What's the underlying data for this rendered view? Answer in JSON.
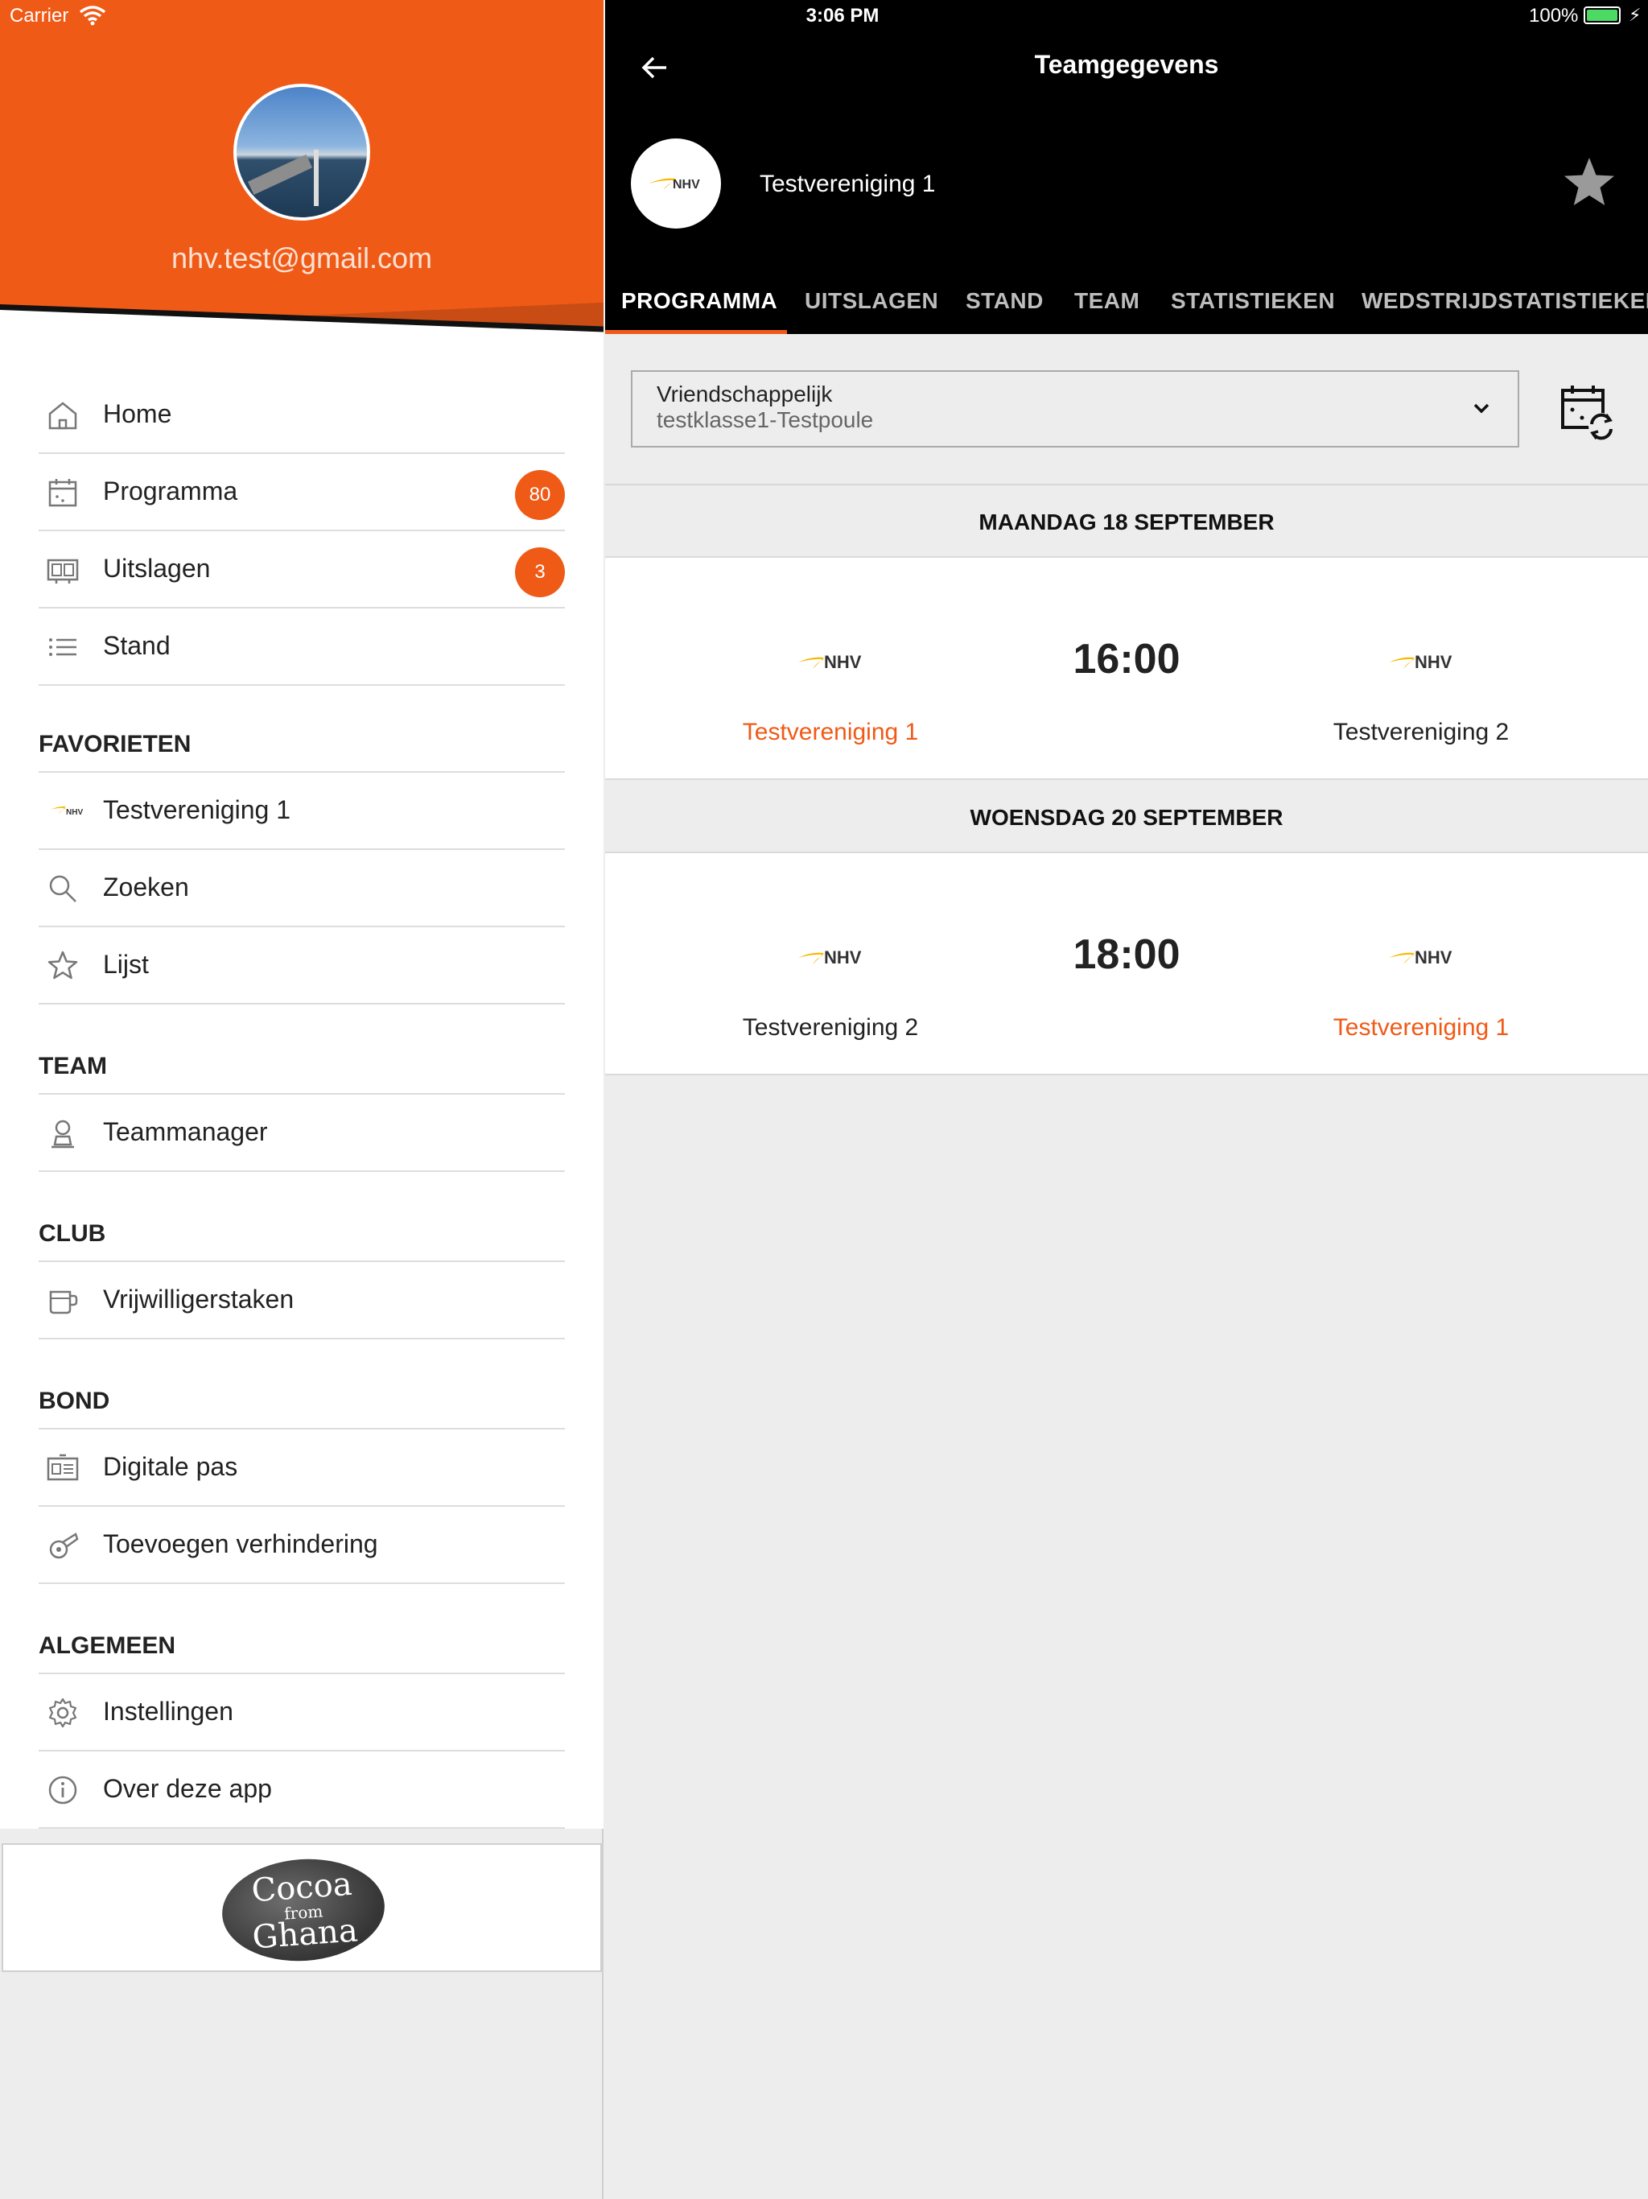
{
  "status_bar": {
    "carrier": "Carrier",
    "time": "3:06 PM",
    "battery": "100%"
  },
  "sidebar": {
    "email": "nhv.test@gmail.com",
    "items": [
      {
        "label": "Home",
        "icon": "home-icon"
      },
      {
        "label": "Programma",
        "icon": "calendar-icon",
        "badge": "80"
      },
      {
        "label": "Uitslagen",
        "icon": "scoreboard-icon",
        "badge": "3"
      },
      {
        "label": "Stand",
        "icon": "list-icon"
      }
    ],
    "sections": {
      "favorieten": {
        "title": "FAVORIETEN",
        "items": [
          {
            "label": "Testvereniging 1",
            "icon": "nhv-logo-icon"
          },
          {
            "label": "Zoeken",
            "icon": "search-icon"
          },
          {
            "label": "Lijst",
            "icon": "star-outline-icon"
          }
        ]
      },
      "team": {
        "title": "TEAM",
        "items": [
          {
            "label": "Teammanager",
            "icon": "person-icon"
          }
        ]
      },
      "club": {
        "title": "CLUB",
        "items": [
          {
            "label": "Vrijwilligerstaken",
            "icon": "cup-icon"
          }
        ]
      },
      "bond": {
        "title": "BOND",
        "items": [
          {
            "label": "Digitale pas",
            "icon": "id-card-icon"
          },
          {
            "label": "Toevoegen verhindering",
            "icon": "whistle-icon"
          }
        ]
      },
      "algemeen": {
        "title": "ALGEMEEN",
        "items": [
          {
            "label": "Instellingen",
            "icon": "gear-icon"
          },
          {
            "label": "Over deze app",
            "icon": "info-icon"
          }
        ]
      }
    },
    "ad": {
      "line1": "Cocoa",
      "line2": "from",
      "line3": "Ghana"
    }
  },
  "header": {
    "title": "Teamgegevens",
    "team_name": "Testvereniging 1",
    "logo_text": "NHV"
  },
  "tabs": [
    "PROGRAMMA",
    "UITSLAGEN",
    "STAND",
    "TEAM",
    "STATISTIEKEN",
    "WEDSTRIJDSTATISTIEKEN"
  ],
  "active_tab": "PROGRAMMA",
  "filter": {
    "competition": "Vriendschappelijk",
    "poule": "testklasse1-Testpoule"
  },
  "schedule": [
    {
      "day": "MAANDAG 18 SEPTEMBER",
      "time": "16:00",
      "home": "Testvereniging 1",
      "away": "Testvereniging 2"
    },
    {
      "day": "WOENSDAG 20 SEPTEMBER",
      "time": "18:00",
      "home": "Testvereniging 2",
      "away": "Testvereniging 1"
    }
  ],
  "colors": {
    "accent": "#f05a17",
    "header_bg": "#000000",
    "logo_yellow": "#f5b800"
  }
}
